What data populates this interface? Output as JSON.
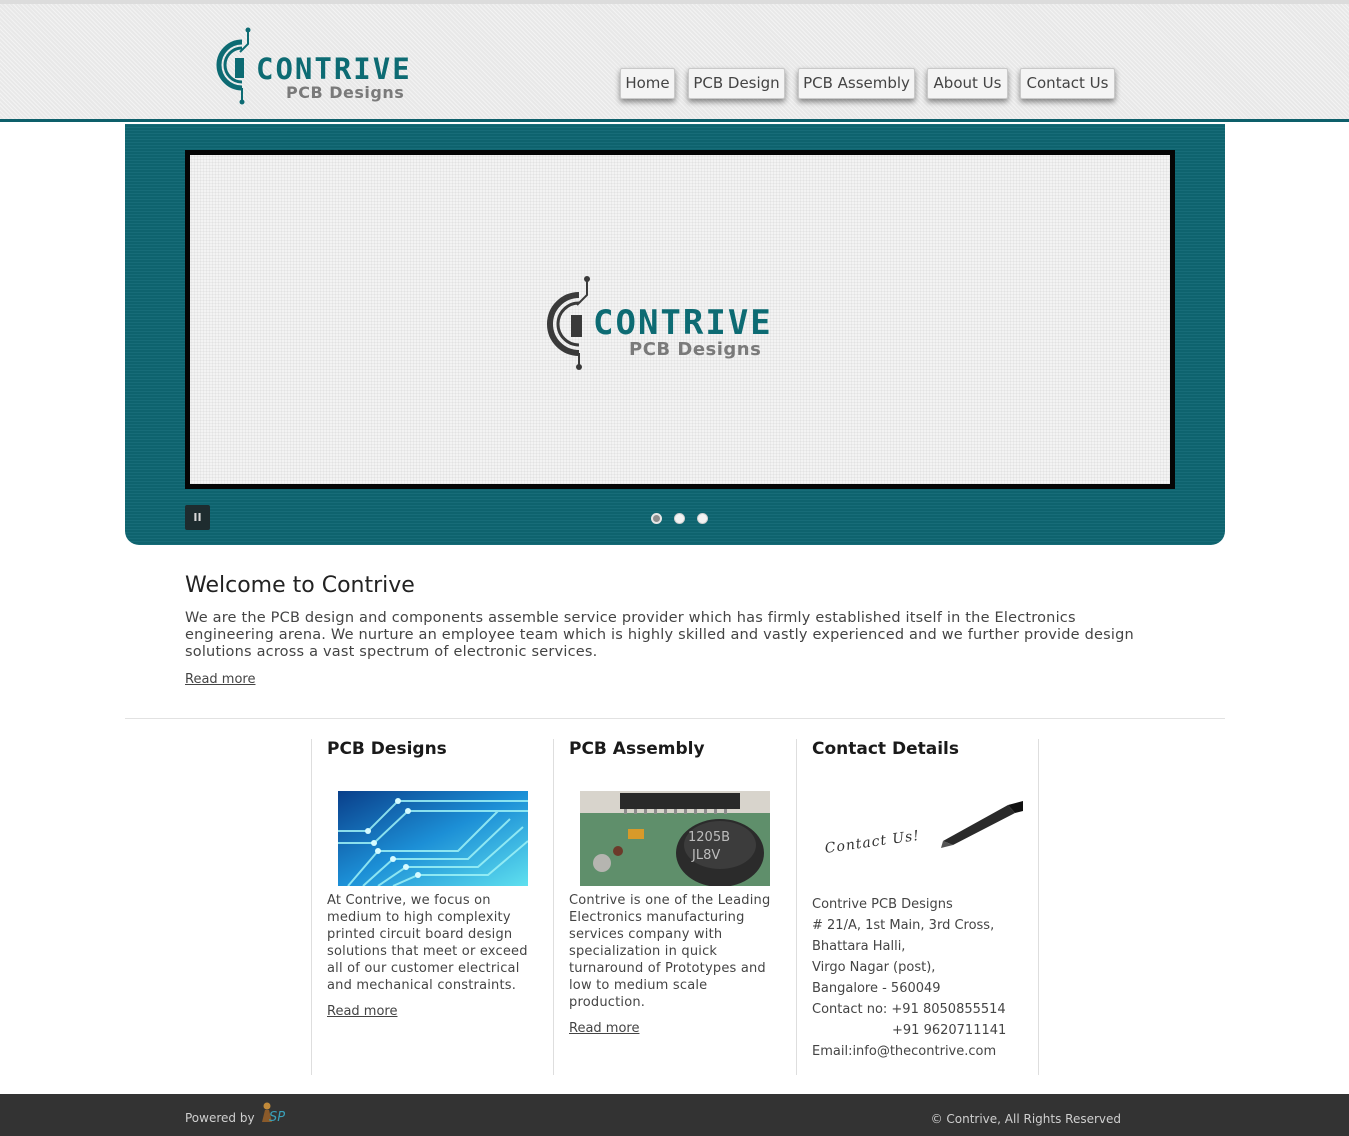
{
  "header": {
    "logo": {
      "word": "CONTRIVE",
      "sub": "PCB Designs"
    },
    "nav": [
      {
        "label": "Home"
      },
      {
        "label": "PCB Design"
      },
      {
        "label": "PCB Assembly"
      },
      {
        "label": "About Us"
      },
      {
        "label": "Contact Us"
      }
    ]
  },
  "slider": {
    "logo": {
      "word": "CONTRIVE",
      "sub": "PCB Designs"
    },
    "pause_label": "II",
    "dots_count": 3,
    "active_dot": 1
  },
  "welcome": {
    "title": "Welcome to Contrive",
    "text": "We are the PCB design and components assemble service provider which has firmly established itself in the Electronics engineering arena. We nurture an employee team which is highly skilled and vastly experienced and we further provide design solutions across a vast spectrum of electronic services.",
    "read_more": "Read more"
  },
  "columns": {
    "pcb_designs": {
      "title": "PCB Designs",
      "text": "At Contrive, we focus on medium to high complexity printed circuit board design solutions that meet or exceed all of our customer electrical and mechanical constraints.",
      "read_more": "Read more"
    },
    "pcb_assembly": {
      "title": "PCB Assembly",
      "text": "Contrive is one of the Leading Electronics manufacturing services company with specialization in quick turnaround of Prototypes and low to medium scale production.",
      "read_more": "Read more",
      "chip_line1": "1205B",
      "chip_line2": "JL8V"
    },
    "contact": {
      "title": "Contact Details",
      "image_text": "Contact Us!",
      "company": "Contrive PCB Designs",
      "address1": "# 21/A, 1st Main, 3rd Cross,",
      "address2": "Bhattara Halli,",
      "address3": "Virgo Nagar (post),",
      "address4": "Bangalore - 560049",
      "phone1": "Contact no: +91 8050855514",
      "phone2": "+91 9620711141",
      "email": "Email:info@thecontrive.com"
    }
  },
  "footer": {
    "powered_by": "Powered by",
    "powered_logo": "SP",
    "copyright": "© Contrive, All Rights Reserved"
  },
  "colors": {
    "brand_teal": "#0f6773",
    "footer_bg": "#333333",
    "header_bg": "#ececec"
  }
}
